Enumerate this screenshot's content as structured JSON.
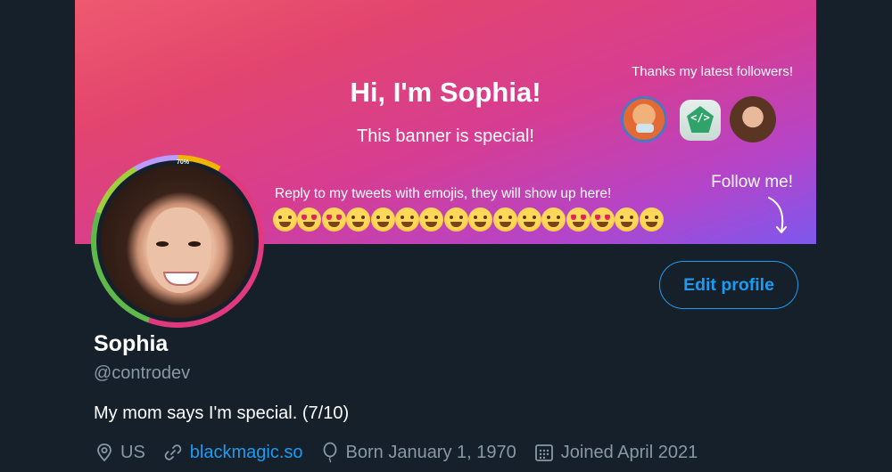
{
  "banner": {
    "title": "Hi, I'm Sophia!",
    "subtitle": "This banner is special!",
    "followers_heading": "Thanks my latest followers!",
    "reply_prompt": "Reply to my tweets with emojis, they will show up here!",
    "follow_cta": "Follow me!",
    "emoji_count": 16
  },
  "avatar": {
    "progress_label": "70%",
    "progress": 0.7
  },
  "profile": {
    "name": "Sophia",
    "handle": "@controdev",
    "bio": "My mom says I'm special. (7/10)",
    "location": "US",
    "website": "blackmagic.so",
    "birthday": "Born January 1, 1970",
    "joined": "Joined April 2021"
  },
  "actions": {
    "edit_profile": "Edit profile"
  },
  "colors": {
    "background": "#15202b",
    "accent": "#1d9bf0",
    "secondary_text": "#8899a6"
  }
}
